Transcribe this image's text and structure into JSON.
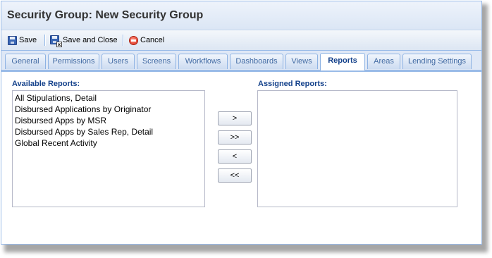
{
  "window": {
    "title": "Security Group: New Security Group"
  },
  "toolbar": {
    "save_label": "Save",
    "save_close_label": "Save and Close",
    "cancel_label": "Cancel",
    "save_icon": "save-disk-icon",
    "save_close_icon": "save-close-icon",
    "cancel_icon": "cancel-icon"
  },
  "tabs": [
    {
      "label": "General"
    },
    {
      "label": "Permissions"
    },
    {
      "label": "Users"
    },
    {
      "label": "Screens"
    },
    {
      "label": "Workflows"
    },
    {
      "label": "Dashboards"
    },
    {
      "label": "Views"
    },
    {
      "label": "Reports",
      "active": true
    },
    {
      "label": "Areas"
    },
    {
      "label": "Lending Settings"
    }
  ],
  "available": {
    "label": "Available Reports:",
    "items": [
      "All Stipulations, Detail",
      "Disbursed Applications by Originator",
      "Disbursed Apps by MSR",
      "Disbursed Apps by Sales Rep, Detail",
      "Global Recent Activity"
    ]
  },
  "assigned": {
    "label": "Assigned Reports:",
    "items": []
  },
  "buttons": {
    "add_one": ">",
    "add_all": ">>",
    "remove_one": "<",
    "remove_all": "<<"
  },
  "colors": {
    "header_text": "#333333",
    "label_text": "#15428b",
    "border": "#99bbe8",
    "panel_bg": "#dfe8f6"
  }
}
